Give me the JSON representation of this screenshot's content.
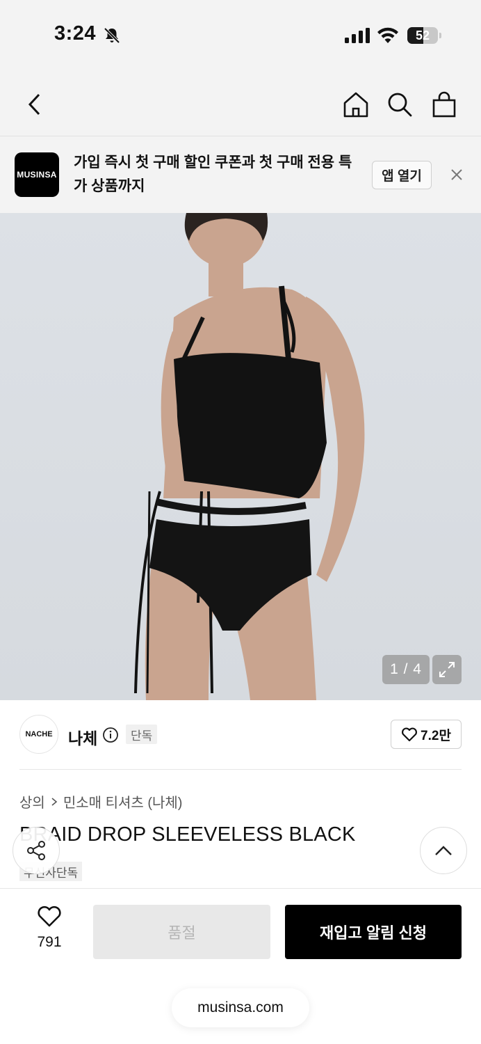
{
  "status_bar": {
    "time": "3:24",
    "battery": "52",
    "battery_fraction": 0.52
  },
  "promo": {
    "logo_text": "MUSINSA",
    "message": "가입 즉시 첫 구매 할인 쿠폰과 첫 구매 전용 특가 상품까지",
    "open_app_label": "앱 열기"
  },
  "gallery": {
    "counter": "1 / 4"
  },
  "brand": {
    "logo_text": "NACHE",
    "name": "나체",
    "exclusive_badge": "단독",
    "like_count": "7.2만"
  },
  "product": {
    "breadcrumb": [
      "상의",
      "민소매 티셔츠 (나체)"
    ],
    "title": "BRAID DROP SLEEVELESS BLACK",
    "tag": "무신사단독"
  },
  "bottom_bar": {
    "wish_count": "791",
    "soldout_label": "품절",
    "restock_label": "재입고 알림 신청"
  },
  "browser": {
    "url": "musinsa.com"
  },
  "colors": {
    "accent": "#000000",
    "background": "#f3f3f3",
    "hero_bg": "#dadde2"
  }
}
